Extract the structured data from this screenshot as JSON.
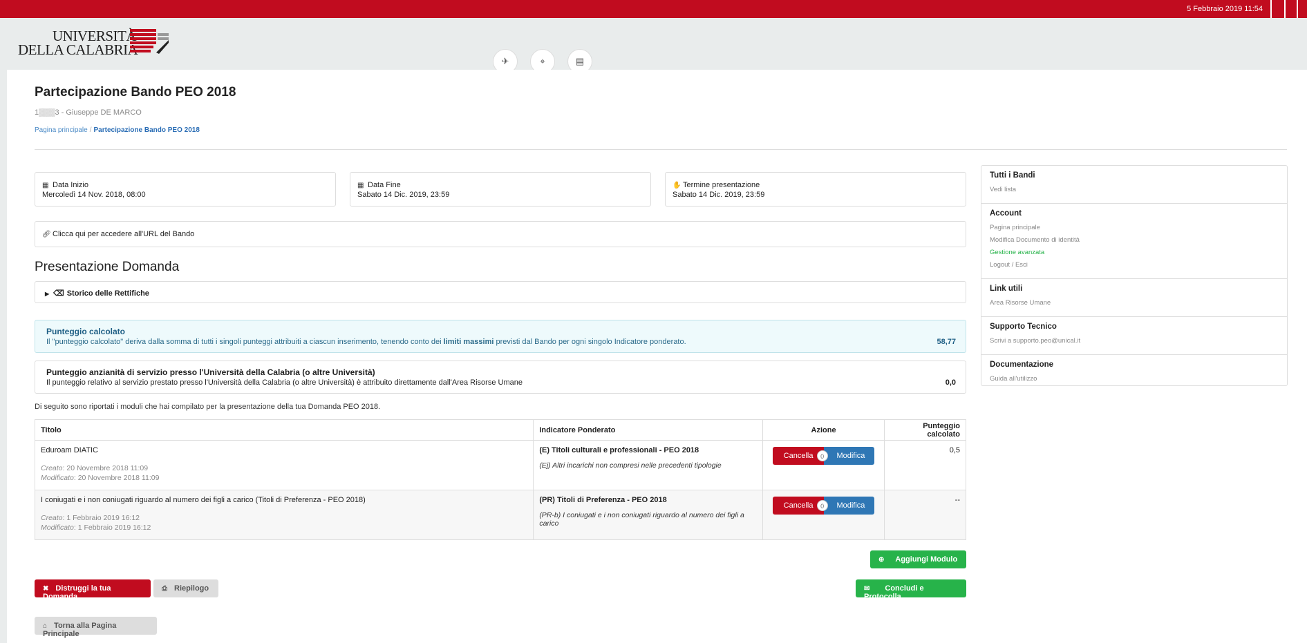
{
  "topbar": {
    "datetime": "5 Febbraio 2019 11:54"
  },
  "logo": {
    "line1": "UNIVERSITÀ",
    "line2": "DELLA CALABRIA"
  },
  "header_icons": [
    "plane-icon",
    "map-icon",
    "id-card-icon"
  ],
  "page": {
    "title": "Partecipazione Bando PEO 2018",
    "subtitle": "1▒▒▒3 - Giuseppe DE MARCO",
    "breadcrumb": {
      "home": "Pagina principale",
      "separator": "/",
      "current": "Partecipazione Bando PEO 2018"
    }
  },
  "info": {
    "start": {
      "label": "Data Inizio",
      "value": "Mercoledì 14 Nov. 2018, 08:00"
    },
    "end": {
      "label": "Data Fine",
      "value": "Sabato 14 Dic. 2019, 23:59"
    },
    "deadline": {
      "label": "Termine presentazione",
      "value": "Sabato 14 Dic. 2019, 23:59"
    },
    "url_label": "Clicca qui per accedere all'URL del Bando"
  },
  "presentation": {
    "title": "Presentazione Domanda",
    "storico": "Storico delle Rettifiche",
    "score_calc": {
      "title": "Punteggio calcolato",
      "text_before": "Il \"punteggio calcolato\" deriva dalla somma di tutti i singoli punteggi attribuiti a ciascun inserimento, tenendo conto dei ",
      "text_bold": "limiti massimi",
      "text_after": " previsti dal Bando per ogni singolo Indicatore ponderato.",
      "value": "58,77"
    },
    "score_service": {
      "title": "Punteggio anzianità di servizio presso l'Università della Calabria (o altre Università)",
      "text": "Il punteggio relativo al servizio prestato presso l'Università della Calabria (o altre Università) è attribuito direttamente dall'Area Risorse Umane",
      "value": "0,0"
    },
    "intro": "Di seguito sono riportati i moduli che hai compilato per la presentazione della tua Domanda PEO 2018."
  },
  "table": {
    "headers": {
      "title": "Titolo",
      "indicator": "Indicatore Ponderato",
      "action": "Azione",
      "score": "Punteggio calcolato"
    },
    "created_label": "Creato",
    "modified_label": "Modificato",
    "delete_label": "Cancella",
    "edit_label": "Modifica",
    "rows": [
      {
        "title": "Eduroam DIATIC",
        "created": ": 20 Novembre 2018 11:09",
        "modified": ": 20 Novembre 2018 11:09",
        "indicator": "(E) Titoli culturali e professionali - PEO 2018",
        "sub_indicator": "(Ej) Altri incarichi non compresi nelle precedenti tipologie",
        "count": "0",
        "score": "0,5"
      },
      {
        "title": "I coniugati e i non coniugati riguardo al numero dei figli a carico (Titoli di Preferenza - PEO 2018)",
        "created": ": 1 Febbraio 2019 16:12",
        "modified": ": 1 Febbraio 2019 16:12",
        "indicator": "(PR) Titoli di Preferenza - PEO 2018",
        "sub_indicator": "(PR-b) I coniugati e i non coniugati riguardo al numero dei figli a carico",
        "count": "0",
        "score": "--"
      }
    ]
  },
  "buttons": {
    "add_module": "Aggiungi Modulo",
    "destroy": "Distruggi la tua Domanda",
    "summary": "Riepilogo",
    "conclude": "Concludi e Protocolla",
    "back": "Torna alla Pagina Principale"
  },
  "sidebar": {
    "groups": [
      {
        "heading": "Tutti i Bandi",
        "items": [
          "Vedi lista"
        ]
      },
      {
        "heading": "Account",
        "items": [
          "Pagina principale",
          "Modifica Documento di identità",
          "Gestione avanzata",
          "Logout / Esci"
        ]
      },
      {
        "heading": "Link utili",
        "items": [
          "Area Risorse Umane"
        ]
      },
      {
        "heading": "Supporto Tecnico",
        "items": [
          "Scrivi a supporto.peo@unical.it"
        ]
      },
      {
        "heading": "Documentazione",
        "items": [
          "Guida all'utilizzo"
        ]
      }
    ]
  },
  "colors": {
    "brand_red": "#c10c1f",
    "success_green": "#27b34a",
    "primary_blue": "#2f77b5",
    "info_bg": "#eefafc"
  }
}
